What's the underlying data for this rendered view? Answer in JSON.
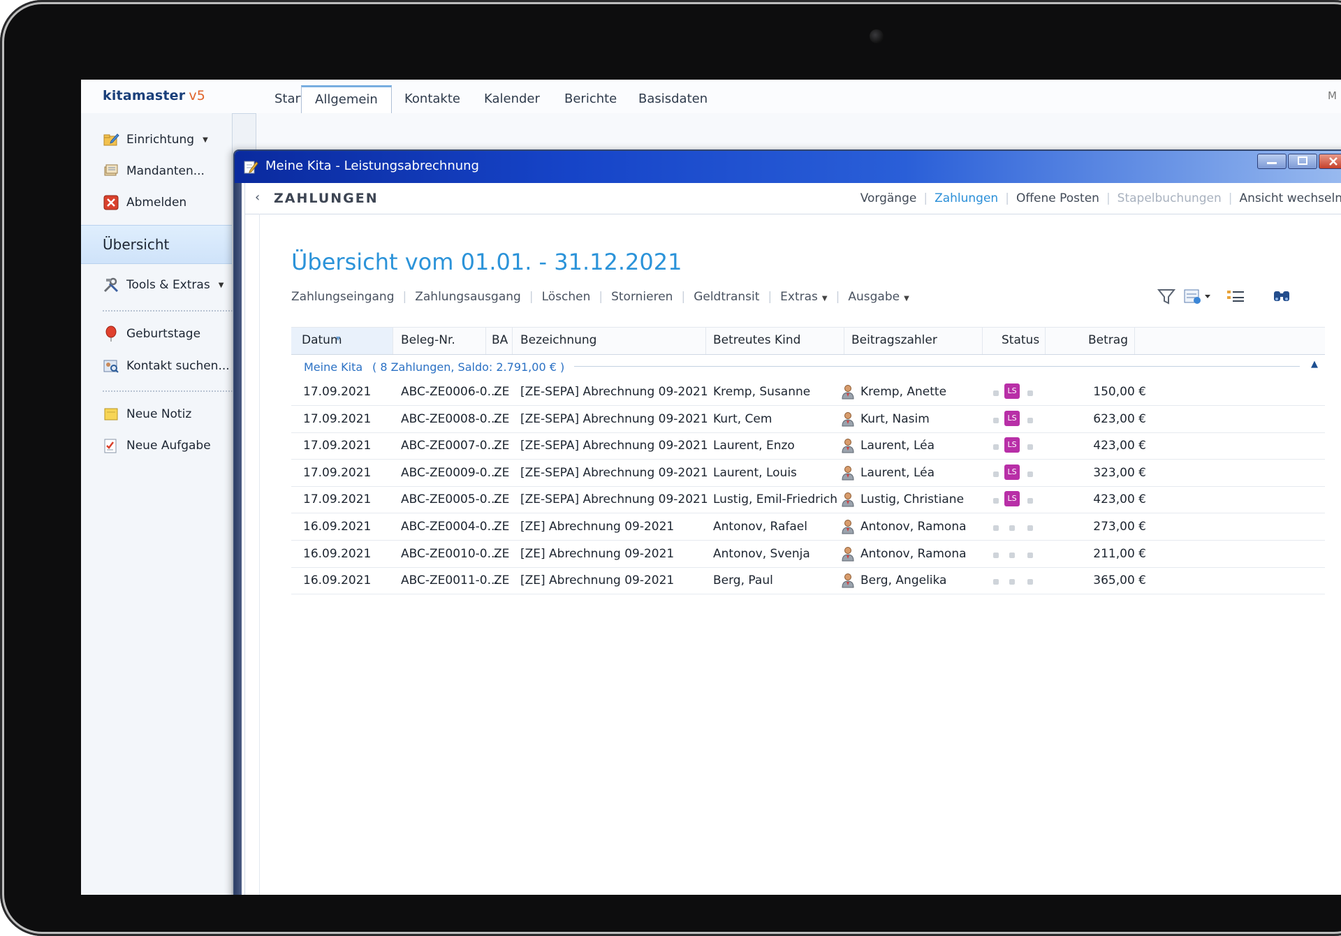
{
  "app": {
    "brand": "kitamaster",
    "version": "v5",
    "corner_letter": "M"
  },
  "ribbon_tabs": [
    {
      "label": "Start",
      "active": false
    },
    {
      "label": "Allgemein",
      "active": true
    },
    {
      "label": "Kontakte",
      "active": false
    },
    {
      "label": "Kalender",
      "active": false
    },
    {
      "label": "Berichte",
      "active": false
    },
    {
      "label": "Basisdaten",
      "active": false
    }
  ],
  "sidebar": {
    "items_top": [
      {
        "label": "Einrichtung",
        "dropdown": true,
        "icon": "folder-edit-icon"
      },
      {
        "label": "Mandanten...",
        "icon": "database-icon"
      },
      {
        "label": "Abmelden",
        "icon": "logout-icon"
      }
    ],
    "selected": "Übersicht",
    "tools": {
      "label": "Tools & Extras",
      "dropdown": true,
      "icon": "tools-icon"
    },
    "items_mid": [
      {
        "label": "Geburtstage",
        "icon": "balloon-icon"
      },
      {
        "label": "Kontakt suchen...",
        "icon": "contact-search-icon"
      }
    ],
    "items_bottom": [
      {
        "label": "Neue Notiz",
        "icon": "note-icon"
      },
      {
        "label": "Neue Aufgabe",
        "icon": "task-icon"
      }
    ]
  },
  "window": {
    "title": "Meine Kita - Leistungsabrechnung",
    "section": "ZAHLUNGEN",
    "subnav": [
      {
        "label": "Vorgänge",
        "state": "normal"
      },
      {
        "label": "Zahlungen",
        "state": "active"
      },
      {
        "label": "Offene Posten",
        "state": "normal"
      },
      {
        "label": "Stapelbuchungen",
        "state": "disabled"
      },
      {
        "label": "Ansicht wechseln",
        "state": "normal"
      }
    ]
  },
  "page": {
    "title": "Übersicht vom 01.01. - 31.12.2021",
    "toolbar": [
      {
        "label": "Zahlungseingang"
      },
      {
        "label": "Zahlungsausgang"
      },
      {
        "label": "Löschen"
      },
      {
        "label": "Stornieren"
      },
      {
        "label": "Geldtransit"
      },
      {
        "label": "Extras",
        "dropdown": true
      },
      {
        "label": "Ausgabe",
        "dropdown": true
      }
    ]
  },
  "table": {
    "columns": [
      "Datum",
      "Beleg-Nr.",
      "BA",
      "Bezeichnung",
      "Betreutes Kind",
      "Beitragszahler",
      "Status",
      "Betrag"
    ],
    "group_label": "Meine Kita",
    "group_summary": "( 8 Zahlungen, Saldo: 2.791,00 € )",
    "rows": [
      {
        "datum": "17.09.2021",
        "beleg": "ABC-ZE0006-0...",
        "ba": "ZE",
        "bezeichnung": "[ZE-SEPA] Abrechnung 09-2021",
        "kind": "Kremp, Susanne",
        "zahler": "Kremp, Anette",
        "ls": true,
        "betrag": "150,00 €"
      },
      {
        "datum": "17.09.2021",
        "beleg": "ABC-ZE0008-0...",
        "ba": "ZE",
        "bezeichnung": "[ZE-SEPA] Abrechnung 09-2021",
        "kind": "Kurt, Cem",
        "zahler": "Kurt, Nasim",
        "ls": true,
        "betrag": "623,00 €"
      },
      {
        "datum": "17.09.2021",
        "beleg": "ABC-ZE0007-0...",
        "ba": "ZE",
        "bezeichnung": "[ZE-SEPA] Abrechnung 09-2021",
        "kind": "Laurent, Enzo",
        "zahler": "Laurent, Léa",
        "ls": true,
        "betrag": "423,00 €"
      },
      {
        "datum": "17.09.2021",
        "beleg": "ABC-ZE0009-0...",
        "ba": "ZE",
        "bezeichnung": "[ZE-SEPA] Abrechnung 09-2021",
        "kind": "Laurent, Louis",
        "zahler": "Laurent, Léa",
        "ls": true,
        "betrag": "323,00 €"
      },
      {
        "datum": "17.09.2021",
        "beleg": "ABC-ZE0005-0...",
        "ba": "ZE",
        "bezeichnung": "[ZE-SEPA] Abrechnung 09-2021",
        "kind": "Lustig, Emil-Friedrich",
        "zahler": "Lustig, Christiane",
        "ls": true,
        "betrag": "423,00 €"
      },
      {
        "datum": "16.09.2021",
        "beleg": "ABC-ZE0004-0...",
        "ba": "ZE",
        "bezeichnung": "[ZE] Abrechnung 09-2021",
        "kind": "Antonov, Rafael",
        "zahler": "Antonov, Ramona",
        "ls": false,
        "betrag": "273,00 €"
      },
      {
        "datum": "16.09.2021",
        "beleg": "ABC-ZE0010-0...",
        "ba": "ZE",
        "bezeichnung": "[ZE] Abrechnung 09-2021",
        "kind": "Antonov, Svenja",
        "zahler": "Antonov, Ramona",
        "ls": false,
        "betrag": "211,00 €"
      },
      {
        "datum": "16.09.2021",
        "beleg": "ABC-ZE0011-0...",
        "ba": "ZE",
        "bezeichnung": "[ZE] Abrechnung 09-2021",
        "kind": "Berg, Paul",
        "zahler": "Berg, Angelika",
        "ls": false,
        "betrag": "365,00 €"
      }
    ],
    "status_badge": "LS"
  },
  "colors": {
    "accent": "#2b93d9",
    "titlebar": "#1644c8",
    "ls_badge": "#b82fa7"
  }
}
